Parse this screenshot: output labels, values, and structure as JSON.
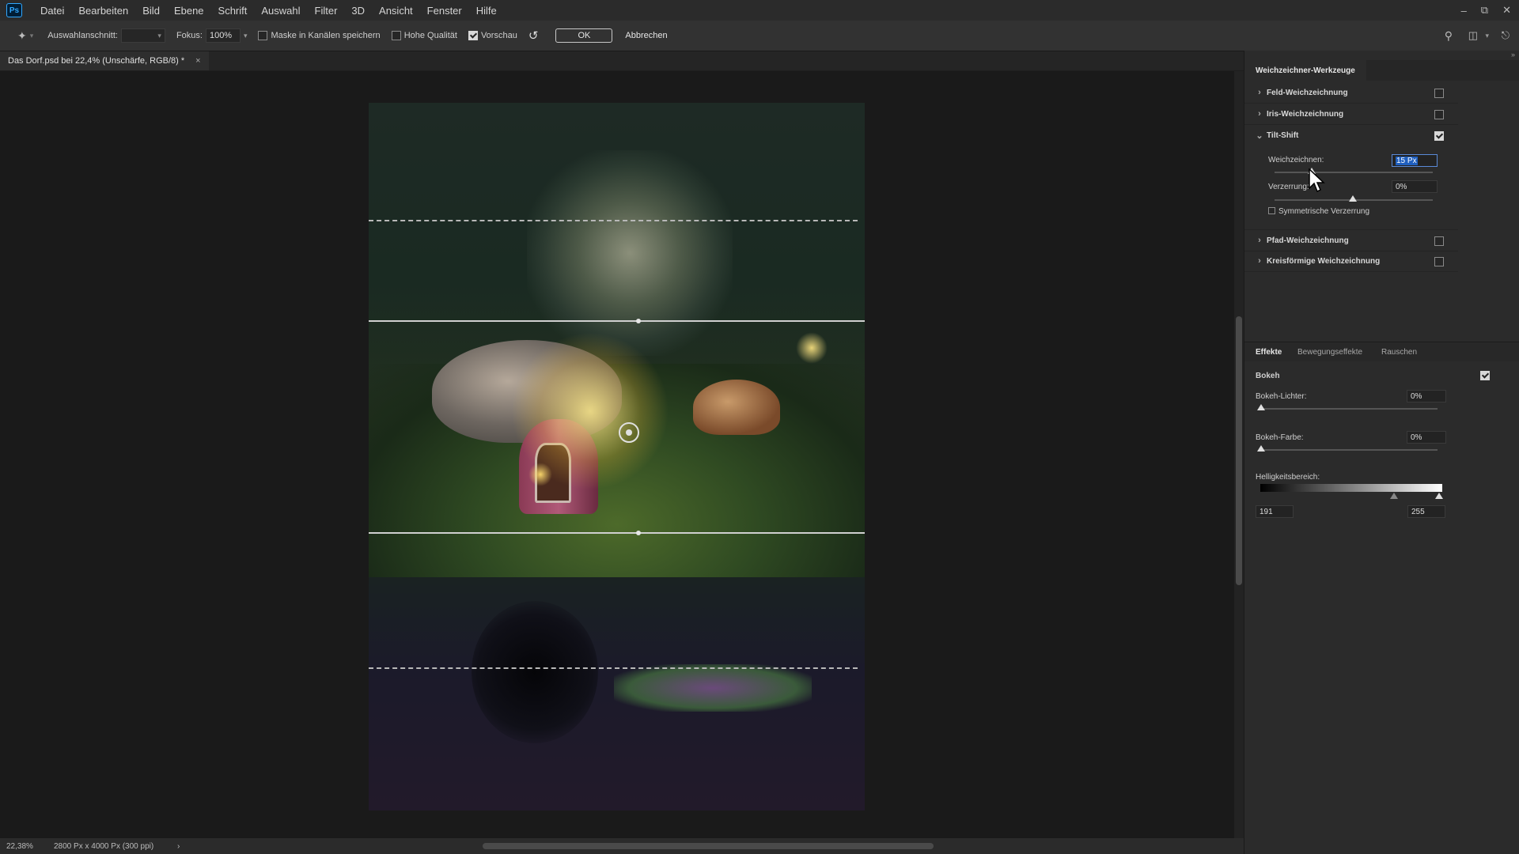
{
  "app": {
    "logo": "Ps"
  },
  "menu": [
    "Datei",
    "Bearbeiten",
    "Bild",
    "Ebene",
    "Schrift",
    "Auswahl",
    "Filter",
    "3D",
    "Ansicht",
    "Fenster",
    "Hilfe"
  ],
  "options": {
    "selection_label": "Auswahlanschnitt:",
    "focus_label": "Fokus:",
    "focus_value": "100%",
    "mask_label": "Maske in Kanälen speichern",
    "mask_checked": false,
    "quality_label": "Hohe Qualität",
    "quality_checked": false,
    "preview_label": "Vorschau",
    "preview_checked": true,
    "ok_label": "OK",
    "cancel_label": "Abbrechen"
  },
  "document": {
    "tab_title": "Das Dorf.psd bei 22,4% (Unschärfe, RGB/8) *",
    "close": "×"
  },
  "status": {
    "zoom": "22,38%",
    "size": "2800 Px x 4000 Px (300 ppi)",
    "arrow": "›"
  },
  "panel": {
    "title": "Weichzeichner-Werkzeuge",
    "blurs": [
      {
        "label": "Feld-Weichzeichnung",
        "checked": false,
        "expanded": false
      },
      {
        "label": "Iris-Weichzeichnung",
        "checked": false,
        "expanded": false
      },
      {
        "label": "Tilt-Shift",
        "checked": true,
        "expanded": true
      },
      {
        "label": "Pfad-Weichzeichnung",
        "checked": false,
        "expanded": false
      },
      {
        "label": "Kreisförmige Weichzeichnung",
        "checked": false,
        "expanded": false
      }
    ],
    "tiltshift": {
      "blur_label": "Weichzeichnen:",
      "blur_value": "15 Px",
      "distortion_label": "Verzerrung:",
      "distortion_value": "0%",
      "symmetric_label": "Symmetrische Verzerrung",
      "symmetric_checked": false
    }
  },
  "effects": {
    "tabs": [
      "Effekte",
      "Bewegungseffekte",
      "Rauschen"
    ],
    "bokeh_label": "Bokeh",
    "bokeh_checked": true,
    "bokeh_lights_label": "Bokeh-Lichter:",
    "bokeh_lights_value": "0%",
    "bokeh_color_label": "Bokeh-Farbe:",
    "bokeh_color_value": "0%",
    "brightness_label": "Helligkeitsbereich:",
    "brightness_low": "191",
    "brightness_high": "255"
  },
  "colors": {
    "accent": "#31a8ff",
    "selection": "#1f5fbf",
    "panel_bg": "#2b2b2b"
  }
}
